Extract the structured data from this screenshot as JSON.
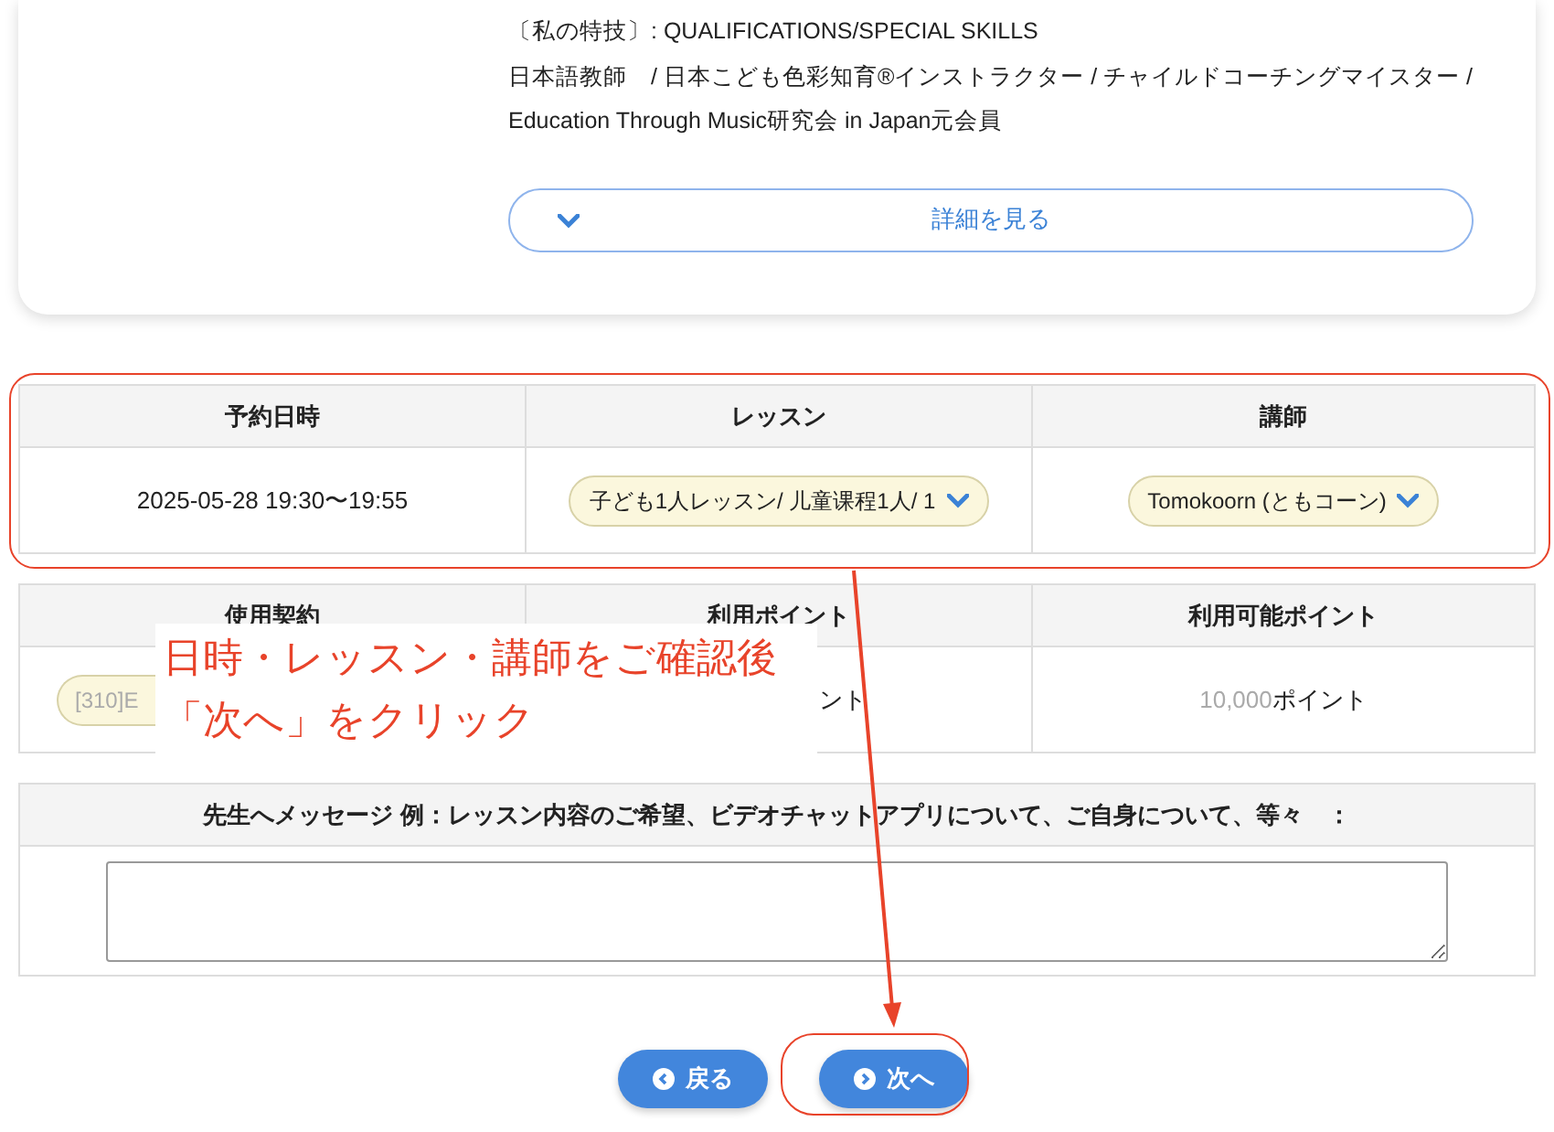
{
  "profile": {
    "lines": [
      "〔私の特技〕: QUALIFICATIONS/SPECIAL SKILLS",
      "日本語教師　/ 日本こども色彩知育®インストラクター / チャイルドコーチングマイスター /",
      "Education Through Music研究会 in Japan元会員"
    ],
    "details_button": "詳細を見る"
  },
  "booking_table": {
    "columns": [
      "予約日時",
      "レッスン",
      "講師"
    ],
    "date": "2025-05-28 19:30〜19:55",
    "lesson_select": "子ども1人レッスン/ 儿童课程1人/ 1",
    "teacher_select": "Tomokoorn (ともコーン)"
  },
  "contract_table": {
    "columns": [
      "使用契約",
      "利用ポイント",
      "利用可能ポイント"
    ],
    "contract_select": "[310]E",
    "points_used": "ント",
    "points_available_value": "10,000",
    "points_available_unit": "ポイント"
  },
  "message": {
    "label": "先生へメッセージ 例：レッスン内容のご希望、ビデオチャットアプリについて、ご自身について、等々　："
  },
  "buttons": [
    {
      "label": "戻る",
      "kind": "back"
    },
    {
      "label": "次へ",
      "kind": "next"
    }
  ],
  "annotation": {
    "lines": [
      "日時・レッスン・講師をご確認後",
      "「次へ」をクリック"
    ]
  }
}
